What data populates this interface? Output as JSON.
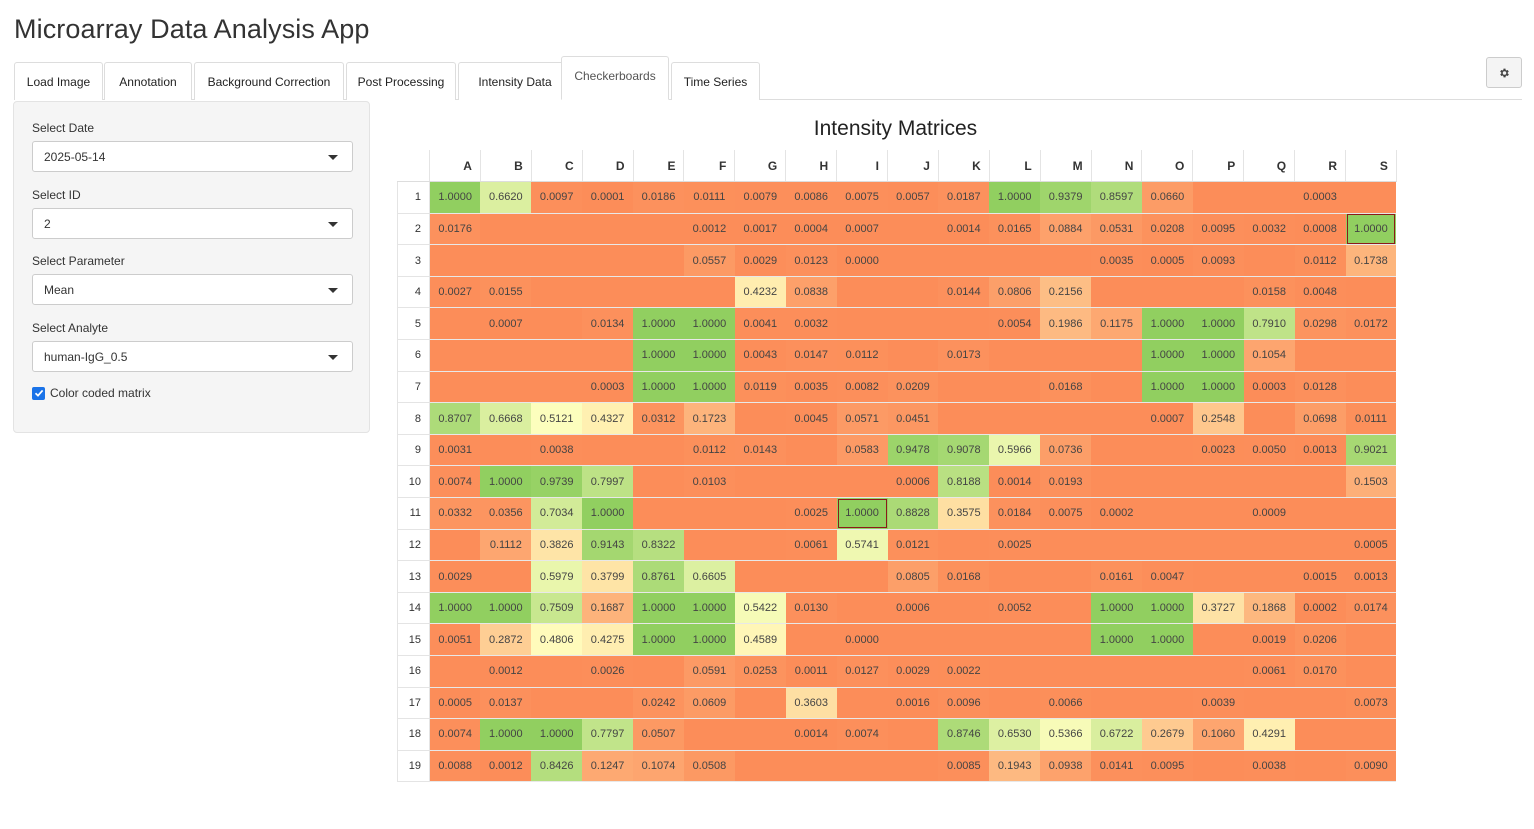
{
  "app": {
    "title": "Microarray Data Analysis App"
  },
  "tabs": [
    {
      "label": "Load Image",
      "active": false
    },
    {
      "label": "Annotation",
      "active": false
    },
    {
      "label": "Background Correction",
      "active": false
    },
    {
      "label": "Post Processing",
      "active": false
    },
    {
      "label": "Intensity Data",
      "active": false
    },
    {
      "label": "Checkerboards",
      "active": true
    },
    {
      "label": "Time Series",
      "active": false
    }
  ],
  "settings_icon": "gear-icon",
  "sidebar": {
    "date": {
      "label": "Select Date",
      "value": "2025-05-14"
    },
    "id": {
      "label": "Select ID",
      "value": "2"
    },
    "parameter": {
      "label": "Select Parameter",
      "value": "Mean"
    },
    "analyte": {
      "label": "Select Analyte",
      "value": "human-IgG_0.5"
    },
    "color_coded": {
      "label": "Color coded matrix",
      "checked": true
    }
  },
  "matrix": {
    "title": "Intensity Matrices",
    "columns": [
      "A",
      "B",
      "C",
      "D",
      "E",
      "F",
      "G",
      "H",
      "I",
      "J",
      "K",
      "L",
      "M",
      "N",
      "O",
      "P",
      "Q",
      "R",
      "S"
    ],
    "rows": [
      {
        "label": "1",
        "cells": [
          "1.0000",
          "0.6620",
          "0.0097",
          "0.0001",
          "0.0186",
          "0.0111",
          "0.0079",
          "0.0086",
          "0.0075",
          "0.0057",
          "0.0187",
          "1.0000",
          "0.9379",
          "0.8597",
          "0.0660",
          "",
          "",
          "0.0003",
          ""
        ]
      },
      {
        "label": "2",
        "cells": [
          "0.0176",
          "",
          "",
          "",
          "",
          "0.0012",
          "0.0017",
          "0.0004",
          "0.0007",
          "",
          "0.0014",
          "0.0165",
          "0.0884",
          "0.0531",
          "0.0208",
          "0.0095",
          "0.0032",
          "0.0008",
          "1.0000"
        ]
      },
      {
        "label": "3",
        "cells": [
          "",
          "",
          "",
          "",
          "",
          "0.0557",
          "0.0029",
          "0.0123",
          "0.0000",
          "",
          "",
          "",
          "",
          "0.0035",
          "0.0005",
          "0.0093",
          "",
          "0.0112",
          "0.1738"
        ]
      },
      {
        "label": "4",
        "cells": [
          "0.0027",
          "0.0155",
          "",
          "",
          "",
          "",
          "0.4232",
          "0.0838",
          "",
          "",
          "0.0144",
          "0.0806",
          "0.2156",
          "",
          "",
          "",
          "0.0158",
          "0.0048",
          ""
        ]
      },
      {
        "label": "5",
        "cells": [
          "",
          "0.0007",
          "",
          "0.0134",
          "1.0000",
          "1.0000",
          "0.0041",
          "0.0032",
          "",
          "",
          "",
          "0.0054",
          "0.1986",
          "0.1175",
          "1.0000",
          "1.0000",
          "0.7910",
          "0.0298",
          "0.0172"
        ]
      },
      {
        "label": "6",
        "cells": [
          "",
          "",
          "",
          "",
          "1.0000",
          "1.0000",
          "0.0043",
          "0.0147",
          "0.0112",
          "",
          "0.0173",
          "",
          "",
          "",
          "1.0000",
          "1.0000",
          "0.1054",
          "",
          ""
        ]
      },
      {
        "label": "7",
        "cells": [
          "",
          "",
          "",
          "0.0003",
          "1.0000",
          "1.0000",
          "0.0119",
          "0.0035",
          "0.0082",
          "0.0209",
          "",
          "",
          "0.0168",
          "",
          "1.0000",
          "1.0000",
          "0.0003",
          "0.0128",
          ""
        ]
      },
      {
        "label": "8",
        "cells": [
          "0.8707",
          "0.6668",
          "0.5121",
          "0.4327",
          "0.0312",
          "0.1723",
          "",
          "0.0045",
          "0.0571",
          "0.0451",
          "",
          "",
          "",
          "",
          "0.0007",
          "0.2548",
          "",
          "0.0698",
          "0.0111"
        ]
      },
      {
        "label": "9",
        "cells": [
          "0.0031",
          "",
          "0.0038",
          "",
          "",
          "0.0112",
          "0.0143",
          "",
          "0.0583",
          "0.9478",
          "0.9078",
          "0.5966",
          "0.0736",
          "",
          "",
          "0.0023",
          "0.0050",
          "0.0013",
          "0.9021"
        ]
      },
      {
        "label": "10",
        "cells": [
          "0.0074",
          "1.0000",
          "0.9739",
          "0.7997",
          "",
          "0.0103",
          "",
          "",
          "",
          "0.0006",
          "0.8188",
          "0.0014",
          "0.0193",
          "",
          "",
          "",
          "",
          "",
          "0.1503"
        ]
      },
      {
        "label": "11",
        "cells": [
          "0.0332",
          "0.0356",
          "0.7034",
          "1.0000",
          "",
          "",
          "",
          "0.0025",
          "1.0000",
          "0.8828",
          "0.3575",
          "0.0184",
          "0.0075",
          "0.0002",
          "",
          "",
          "0.0009",
          "",
          ""
        ]
      },
      {
        "label": "12",
        "cells": [
          "",
          "0.1112",
          "0.3826",
          "0.9143",
          "0.8322",
          "",
          "",
          "0.0061",
          "0.5741",
          "0.0121",
          "",
          "0.0025",
          "",
          "",
          "",
          "",
          "",
          "",
          "0.0005"
        ]
      },
      {
        "label": "13",
        "cells": [
          "0.0029",
          "",
          "0.5979",
          "0.3799",
          "0.8761",
          "0.6605",
          "",
          "",
          "",
          "0.0805",
          "0.0168",
          "",
          "",
          "0.0161",
          "0.0047",
          "",
          "",
          "0.0015",
          "0.0013"
        ]
      },
      {
        "label": "14",
        "cells": [
          "1.0000",
          "1.0000",
          "0.7509",
          "0.1687",
          "1.0000",
          "1.0000",
          "0.5422",
          "0.0130",
          "",
          "0.0006",
          "",
          "0.0052",
          "",
          "1.0000",
          "1.0000",
          "0.3727",
          "0.1868",
          "0.0002",
          "0.0174"
        ]
      },
      {
        "label": "15",
        "cells": [
          "0.0051",
          "0.2872",
          "0.4806",
          "0.4275",
          "1.0000",
          "1.0000",
          "0.4589",
          "",
          "0.0000",
          "",
          "",
          "",
          "",
          "1.0000",
          "1.0000",
          "",
          "0.0019",
          "0.0206",
          ""
        ]
      },
      {
        "label": "16",
        "cells": [
          "",
          "0.0012",
          "",
          "0.0026",
          "",
          "0.0591",
          "0.0253",
          "0.0011",
          "0.0127",
          "0.0029",
          "0.0022",
          "",
          "",
          "",
          "",
          "",
          "0.0061",
          "0.0170",
          ""
        ]
      },
      {
        "label": "17",
        "cells": [
          "0.0005",
          "0.0137",
          "",
          "",
          "0.0242",
          "0.0609",
          "",
          "0.3603",
          "",
          "0.0016",
          "0.0096",
          "",
          "0.0066",
          "",
          "",
          "0.0039",
          "",
          "",
          "0.0073"
        ]
      },
      {
        "label": "18",
        "cells": [
          "0.0074",
          "1.0000",
          "1.0000",
          "0.7797",
          "0.0507",
          "",
          "",
          "0.0014",
          "0.0074",
          "",
          "0.8746",
          "0.6530",
          "0.5366",
          "0.6722",
          "0.2679",
          "0.1060",
          "0.4291",
          "",
          ""
        ]
      },
      {
        "label": "19",
        "cells": [
          "0.0088",
          "0.0012",
          "0.8426",
          "0.1247",
          "0.1074",
          "0.0508",
          "",
          "",
          "",
          "",
          "0.0085",
          "0.1943",
          "0.0938",
          "0.0141",
          "0.0095",
          "",
          "0.0038",
          "",
          "0.0090"
        ]
      }
    ],
    "highlighted_cells": [
      {
        "row": "2",
        "col": "S"
      },
      {
        "row": "11",
        "col": "I"
      }
    ],
    "colors": {
      "low": "#fc8d59",
      "mid": "#ffffbf",
      "high": "#91cf60",
      "highlight_border": "#8b1a1a"
    }
  }
}
